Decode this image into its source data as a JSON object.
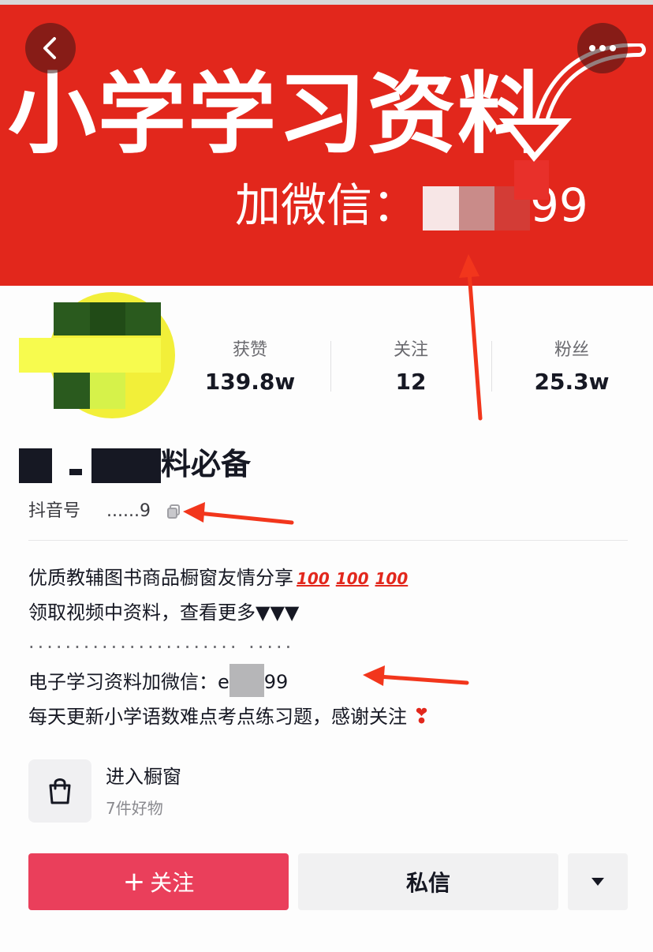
{
  "banner": {
    "title": "小学学习资料",
    "wechat_label": "加微信：",
    "wechat_suffix": "99",
    "background_color": "#e2271c"
  },
  "nav": {
    "back_icon": "chevron-left-icon",
    "more_icon": "more-dots-icon"
  },
  "stats": [
    {
      "label": "获赞",
      "value": "139.8w"
    },
    {
      "label": "关注",
      "value": "12"
    },
    {
      "label": "粉丝",
      "value": "25.3w"
    }
  ],
  "profile": {
    "name_visible_suffix": "料必备",
    "douyin_id_label": "抖音号",
    "douyin_id_value": "......9"
  },
  "bio": {
    "line1": "优质教辅图书商品橱窗友情分享",
    "hundred": "100",
    "line2": "领取视频中资料，查看更多▼▼▼",
    "line3": "·······················      ·····",
    "line4_prefix": "电子学习资料加微信：e",
    "line4_suffix": "99",
    "line5": "每天更新小学语数难点考点练习题，感谢关注",
    "heart": "❣"
  },
  "shop": {
    "title": "进入橱窗",
    "subtitle": "7件好物",
    "icon": "shopping-bag-icon"
  },
  "actions": {
    "follow_plus": "+",
    "follow_label": "关注",
    "message_label": "私信",
    "dropdown_icon": "triangle-down-icon",
    "follow_color": "#ea3f5b"
  }
}
